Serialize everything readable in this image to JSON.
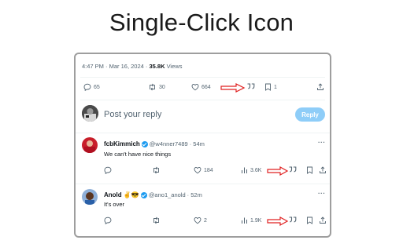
{
  "page_title": "Single-Click Icon",
  "tweet": {
    "time": "4:47 PM · Mar 16, 2024 · ",
    "views_count": "35.8K",
    "views_label": " Views",
    "replies": "65",
    "reposts": "30",
    "likes": "664",
    "bookmarks": "1"
  },
  "reply_box": {
    "placeholder": "Post your reply",
    "button_label": "Reply"
  },
  "replies": [
    {
      "name": "fcbKimmich",
      "handle": "@w4nner7489",
      "time": "· 54m",
      "text": "We can't have nice things",
      "likes": "184",
      "views": "3.6K",
      "menu": "···"
    },
    {
      "name": "Anold ✌️😎",
      "handle": "@ano1_anold",
      "time": "· 52m",
      "text": "It's over",
      "likes": "2",
      "views": "1.9K",
      "menu": "···"
    }
  ],
  "icons": {
    "quote": "quote-icon",
    "arrow": "red-arrow-annotation"
  },
  "colors": {
    "accent": "#1d9bf0",
    "reply_button": "#8ecdf8",
    "annotation": "#e02020"
  }
}
